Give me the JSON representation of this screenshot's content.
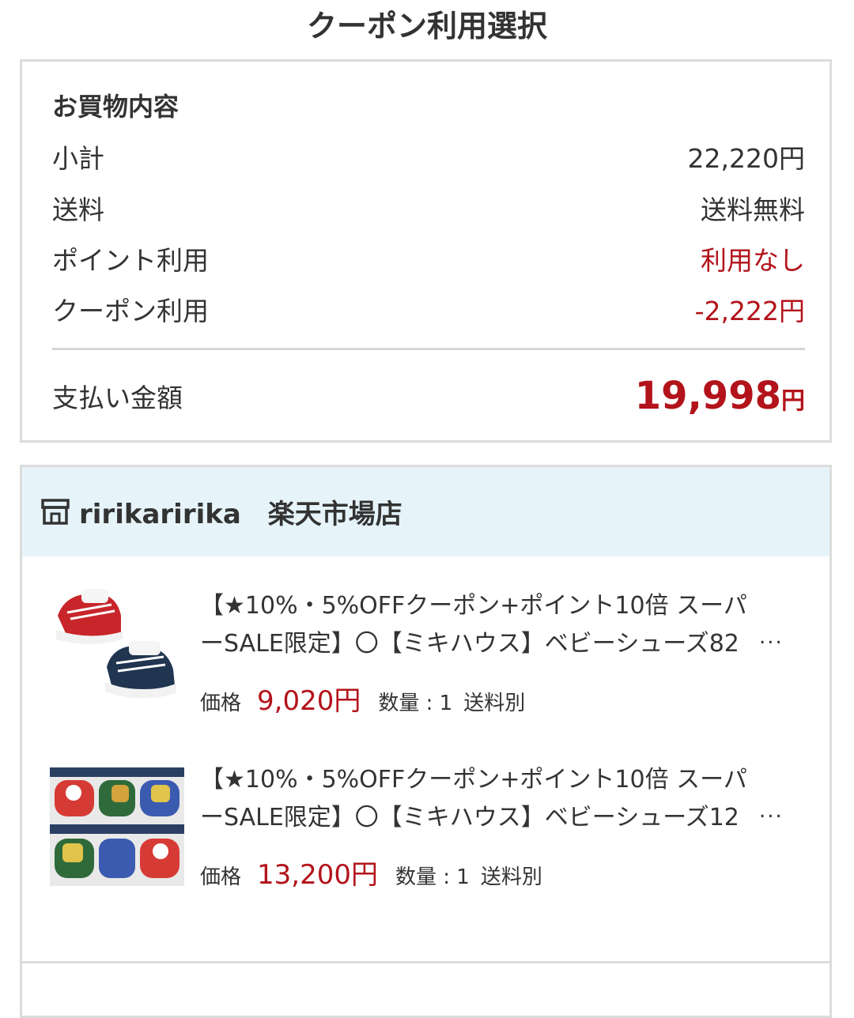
{
  "page": {
    "title": "クーポン利用選択"
  },
  "summary": {
    "heading": "お買物内容",
    "rows": [
      {
        "label": "小計",
        "value": "22,220円"
      },
      {
        "label": "送料",
        "value": "送料無料"
      },
      {
        "label": "ポイント利用",
        "value": "利用なし"
      },
      {
        "label": "クーポン利用",
        "value": "-2,222円"
      }
    ],
    "total_label": "支払い金額",
    "total_value": "19,998",
    "total_unit": "円"
  },
  "shop": {
    "name": "ririkaririka　楽天市場店",
    "icon": "shop-icon",
    "items": [
      {
        "title": "【★10%・5%OFFクーポン+ポイント10倍 スーパーSALE限定】〇【ミキハウス】ベビーシューズ82",
        "ellipsis": "...",
        "price_label": "価格",
        "price": "9,020円",
        "qty_label": "数量 : 1",
        "shipping": "送料別"
      },
      {
        "title": "【★10%・5%OFFクーポン+ポイント10倍 スーパーSALE限定】〇【ミキハウス】ベビーシューズ12",
        "ellipsis": "...",
        "price_label": "価格",
        "price": "13,200円",
        "qty_label": "数量 : 1",
        "shipping": "送料別"
      }
    ]
  },
  "colors": {
    "accent_red": "#b3131b",
    "header_bg": "#e6f4fa",
    "border": "#dcdcdc",
    "text": "#333333"
  }
}
